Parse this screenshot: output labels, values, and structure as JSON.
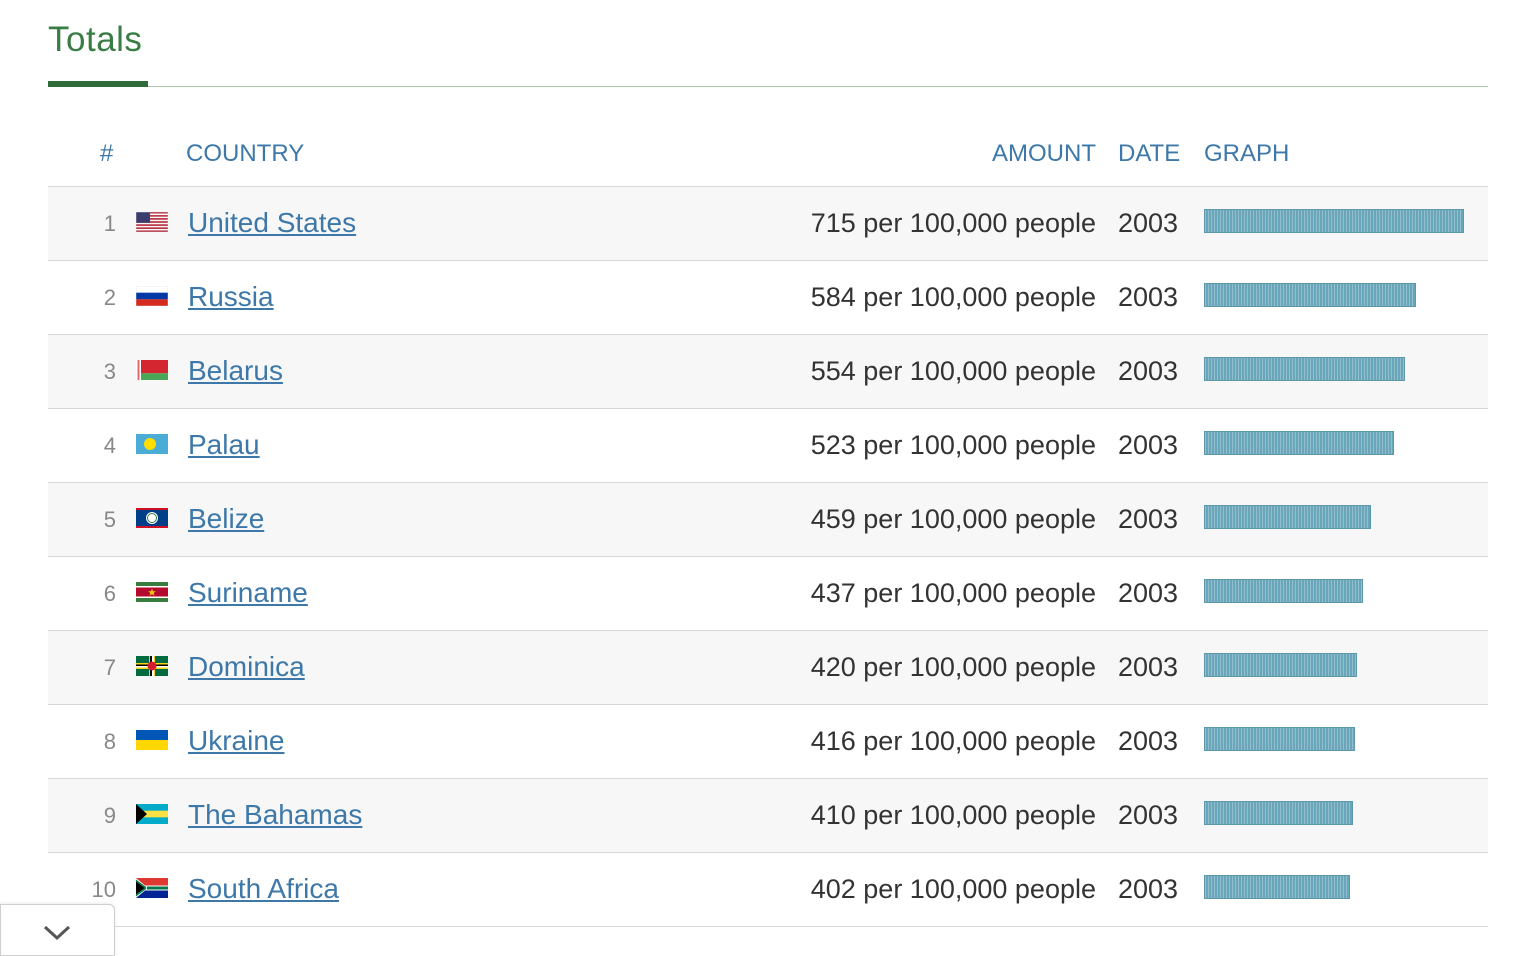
{
  "section": {
    "title": "Totals"
  },
  "table": {
    "headers": {
      "rank": "#",
      "country": "COUNTRY",
      "amount": "AMOUNT",
      "date": "DATE",
      "graph": "GRAPH"
    },
    "rows": [
      {
        "rank": "1",
        "country": "United States",
        "amount": "715 per 100,000 people",
        "date": "2003",
        "value": 715,
        "flag": "us-flag"
      },
      {
        "rank": "2",
        "country": "Russia",
        "amount": "584 per 100,000 people",
        "date": "2003",
        "value": 584,
        "flag": "russia-flag"
      },
      {
        "rank": "3",
        "country": "Belarus",
        "amount": "554 per 100,000 people",
        "date": "2003",
        "value": 554,
        "flag": "belarus-flag"
      },
      {
        "rank": "4",
        "country": "Palau",
        "amount": "523 per 100,000 people",
        "date": "2003",
        "value": 523,
        "flag": "palau-flag"
      },
      {
        "rank": "5",
        "country": "Belize",
        "amount": "459 per 100,000 people",
        "date": "2003",
        "value": 459,
        "flag": "belize-flag"
      },
      {
        "rank": "6",
        "country": "Suriname",
        "amount": "437 per 100,000 people",
        "date": "2003",
        "value": 437,
        "flag": "suriname-flag"
      },
      {
        "rank": "7",
        "country": "Dominica",
        "amount": "420 per 100,000 people",
        "date": "2003",
        "value": 420,
        "flag": "dominica-flag"
      },
      {
        "rank": "8",
        "country": "Ukraine",
        "amount": "416 per 100,000 people",
        "date": "2003",
        "value": 416,
        "flag": "ukraine-flag"
      },
      {
        "rank": "9",
        "country": "The Bahamas",
        "amount": "410 per 100,000 people",
        "date": "2003",
        "value": 410,
        "flag": "bahamas-flag"
      },
      {
        "rank": "10",
        "country": "South Africa",
        "amount": "402 per 100,000 people",
        "date": "2003",
        "value": 402,
        "flag": "south-africa-flag"
      }
    ]
  },
  "colors": {
    "accent_green": "#2f6b3a",
    "link_blue": "#3d78a8",
    "bar_blue": "#6aa6ba"
  },
  "collapse": {
    "icon": "chevron-down-icon"
  }
}
